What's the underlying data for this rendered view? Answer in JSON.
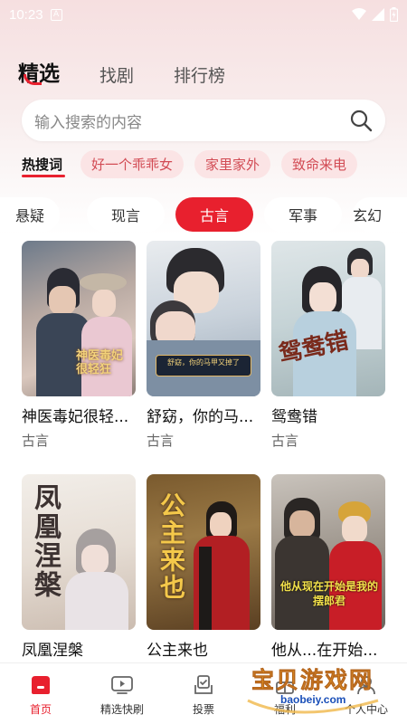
{
  "status_bar": {
    "time": "10:23",
    "notification_letter": "A"
  },
  "header": {
    "tabs": [
      {
        "label": "精选",
        "active": true
      },
      {
        "label": "找剧",
        "active": false
      },
      {
        "label": "排行榜",
        "active": false
      }
    ]
  },
  "search": {
    "placeholder": "输入搜索的内容"
  },
  "hot": {
    "label": "热搜词",
    "chips": [
      "好一个乖乖女",
      "家里家外",
      "致命来电"
    ]
  },
  "categories": [
    {
      "label": "悬疑",
      "active": false
    },
    {
      "label": "现言",
      "active": false
    },
    {
      "label": "古言",
      "active": true
    },
    {
      "label": "军事",
      "active": false
    },
    {
      "label": "玄幻",
      "active": false
    }
  ],
  "cards": [
    {
      "title": "神医毒妃很轻...",
      "tag": "古言",
      "poster_text": "神医毒妃很轻狂"
    },
    {
      "title": "舒窈，你的马...",
      "tag": "古言",
      "poster_text": "舒窈，你的马甲又掉了"
    },
    {
      "title": "鸳鸯错",
      "tag": "古言",
      "poster_text": "鸳鸯错"
    },
    {
      "title": "凤凰涅槃",
      "tag": "",
      "poster_text": "凤凰涅槃"
    },
    {
      "title": "公主来也",
      "tag": "",
      "poster_text": "公主来也"
    },
    {
      "title": "他从...在开始...",
      "tag": "",
      "poster_text": "他从现在开始是我的摆郎君"
    }
  ],
  "bottom_nav": [
    {
      "label": "首页",
      "icon": "home-icon",
      "active": true
    },
    {
      "label": "精选快刷",
      "icon": "video-play-icon",
      "active": false
    },
    {
      "label": "投票",
      "icon": "vote-icon",
      "active": false
    },
    {
      "label": "福利",
      "icon": "gift-icon",
      "active": false
    },
    {
      "label": "个人中心",
      "icon": "person-icon",
      "active": false
    }
  ],
  "watermark": {
    "text": "宝贝游戏网",
    "url": "baobeiy.com"
  },
  "colors": {
    "accent": "#e8202e",
    "chip_bg": "#fbe4e5",
    "chip_text": "#d24b54"
  }
}
